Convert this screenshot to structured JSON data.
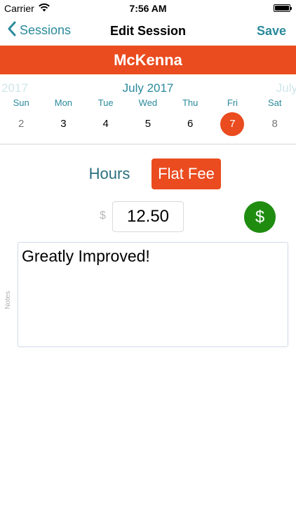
{
  "status_bar": {
    "carrier": "Carrier",
    "time": "7:56 AM",
    "battery_level": 1.0,
    "wifi_icon": "wifi-icon",
    "battery_icon": "battery-icon"
  },
  "nav": {
    "back_label": "Sessions",
    "title": "Edit Session",
    "save_label": "Save",
    "back_icon": "chevron-left-icon"
  },
  "client": {
    "name": "McKenna"
  },
  "calendar": {
    "prev_label": "2017",
    "current_label": "July 2017",
    "next_label": "July",
    "weekdays": [
      "Sun",
      "Mon",
      "Tue",
      "Wed",
      "Thu",
      "Fri",
      "Sat"
    ],
    "days": [
      "2",
      "3",
      "4",
      "5",
      "6",
      "7",
      "8"
    ],
    "selected_index": 5
  },
  "rate": {
    "hours_label": "Hours",
    "flat_fee_label": "Flat Fee",
    "selected": "Flat Fee"
  },
  "amount": {
    "currency_symbol": "$",
    "value": "12.50",
    "button_symbol": "$"
  },
  "notes": {
    "label": "Notes",
    "value": "Greatly Improved!"
  },
  "colors": {
    "accent": "#ea4b1f",
    "link": "#2a8a9c",
    "money_green": "#1f8c10"
  }
}
